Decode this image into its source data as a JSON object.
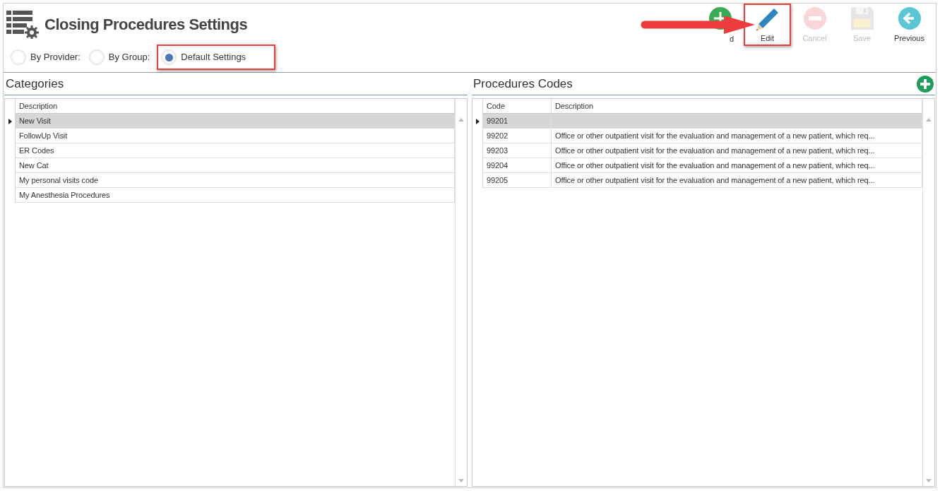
{
  "window": {
    "title": "Closing Procedures Settings"
  },
  "toolbar": [
    {
      "kind": "add",
      "label": "d",
      "disabled": false,
      "highlighted": false
    },
    {
      "kind": "edit",
      "label": "Edit",
      "disabled": false,
      "highlighted": true
    },
    {
      "kind": "cancel",
      "label": "Cancel",
      "disabled": true,
      "highlighted": false
    },
    {
      "kind": "save",
      "label": "Save",
      "disabled": true,
      "highlighted": false
    },
    {
      "kind": "previous",
      "label": "Previous",
      "disabled": false,
      "highlighted": false
    }
  ],
  "scope_options": [
    {
      "label": "By Provider:",
      "selected": false,
      "highlighted": false
    },
    {
      "label": "By Group:",
      "selected": false,
      "highlighted": false
    },
    {
      "label": "Default Settings",
      "selected": true,
      "highlighted": true
    }
  ],
  "categories": {
    "title": "Categories",
    "columns": [
      "Description"
    ],
    "rows": [
      {
        "cells": [
          "New Visit"
        ],
        "selected": true
      },
      {
        "cells": [
          "FollowUp Visit"
        ],
        "selected": false
      },
      {
        "cells": [
          "ER Codes"
        ],
        "selected": false
      },
      {
        "cells": [
          "New Cat"
        ],
        "selected": false
      },
      {
        "cells": [
          "My personal visits code"
        ],
        "selected": false
      },
      {
        "cells": [
          "My Anesthesia Procedures"
        ],
        "selected": false
      }
    ]
  },
  "procedure_codes": {
    "title": "Procedures Codes",
    "columns": [
      "Code",
      "Description"
    ],
    "rows": [
      {
        "cells": [
          "99201"
        ],
        "selected": true
      },
      {
        "cells": [
          "99202",
          "Office or other outpatient visit for the evaluation and management of a new patient, which req..."
        ],
        "selected": false
      },
      {
        "cells": [
          "99203",
          "Office or other outpatient visit for the evaluation and management of a new patient, which req..."
        ],
        "selected": false
      },
      {
        "cells": [
          "99204",
          "Office or other outpatient visit for the evaluation and management of a new patient, which req..."
        ],
        "selected": false
      },
      {
        "cells": [
          "99205",
          "Office or other outpatient visit for the evaluation and management of a new patient, which req..."
        ],
        "selected": false
      }
    ]
  }
}
